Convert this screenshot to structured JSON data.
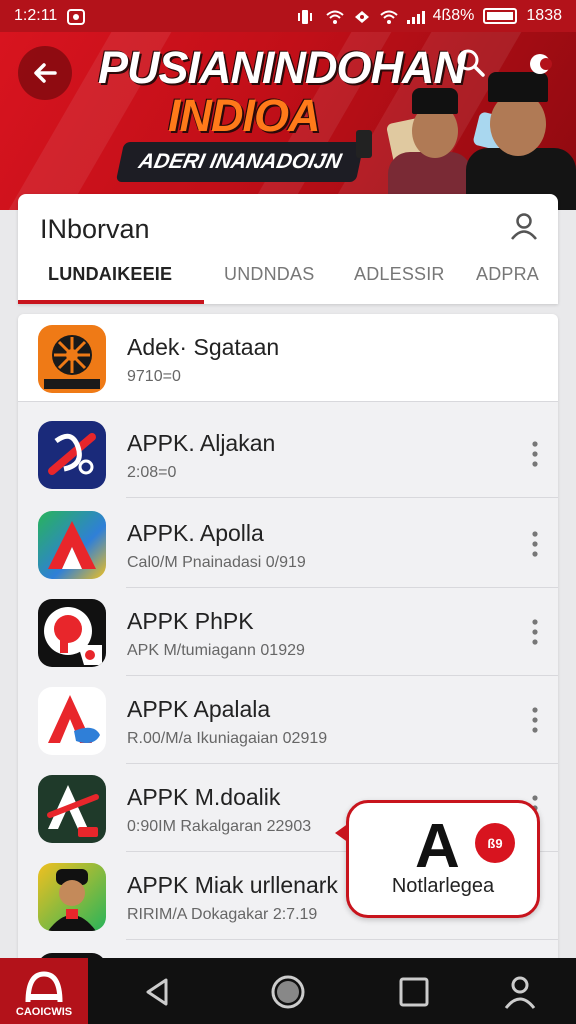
{
  "status_bar": {
    "time": "1:2:11",
    "battery_text": "4ß8%",
    "clock_right": "1838"
  },
  "banner": {
    "title_line1": "PUSIANINDOHAN",
    "title_line2": "INDIOA",
    "subtitle": "ADERI INANADOIJN"
  },
  "card": {
    "title": "INborvan",
    "tabs": [
      {
        "label": "LUNDAIKEEIE",
        "active": true
      },
      {
        "label": "UNDNDAS",
        "active": false
      },
      {
        "label": "ADLESSIR",
        "active": false
      },
      {
        "label": "ADPRA",
        "active": false
      }
    ]
  },
  "apps": [
    {
      "title": "Adek· Sgataan",
      "subtitle": "9710=0",
      "icon": "film-reel-icon",
      "icon_colors": [
        "#ef7a16",
        "#1a1a1a"
      ]
    },
    {
      "title": "APPK. Aljakan",
      "subtitle": "2:08=0",
      "icon": "swirl-app-icon",
      "icon_colors": [
        "#1a2a7a",
        "#e8262b"
      ]
    },
    {
      "title": "APPK. Apolla",
      "subtitle": "Cal0/M Pnainadasi 0/919",
      "icon": "arrow-a-app-icon",
      "icon_colors": [
        "#28b45a",
        "#e8262b"
      ]
    },
    {
      "title": "APPK PhPK",
      "subtitle": "APK M/tumiagann 01929",
      "icon": "p-badge-app-icon",
      "icon_colors": [
        "#111111",
        "#e8262b"
      ]
    },
    {
      "title": "APPK Apalala",
      "subtitle": "R.00/M/a Ikuniagaian 02919",
      "icon": "a-logo-app-icon",
      "icon_colors": [
        "#e8262b",
        "#2f7fd8"
      ]
    },
    {
      "title": "APPK M.doalik",
      "subtitle": "0:90IM Rakalgaran 22903",
      "icon": "a-dark-app-icon",
      "icon_colors": [
        "#1f3a2a",
        "#e8262b"
      ]
    },
    {
      "title": "APPK Miak urllenark",
      "subtitle": "RIRIM/A Dokagakar 2:7.19",
      "icon": "character-app-icon",
      "icon_colors": [
        "#f0c020",
        "#111111"
      ]
    }
  ],
  "popup": {
    "letter": "A",
    "badge": "ß9",
    "label": "Notlarlegea"
  },
  "nav": {
    "logo_text": "CAOICWIS"
  },
  "colors": {
    "brand_red": "#c8141d",
    "dark": "#111111",
    "text": "#222222"
  }
}
